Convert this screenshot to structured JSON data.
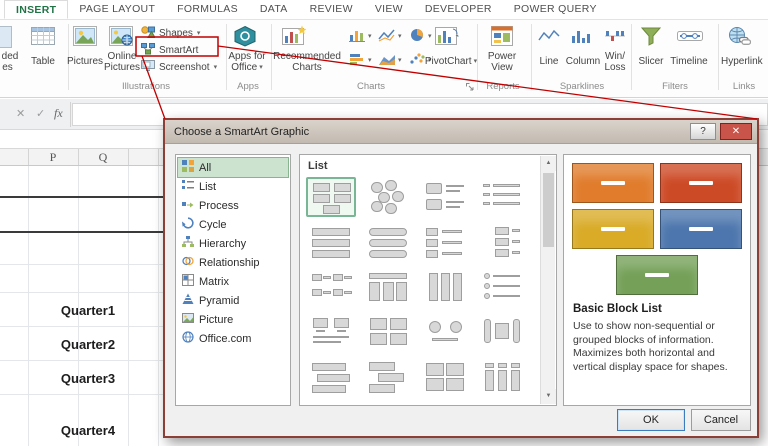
{
  "ribbon": {
    "dropdown_glyph": "▾",
    "tabs": [
      {
        "label": "INSERT",
        "active": true
      },
      {
        "label": "PAGE LAYOUT",
        "active": false
      },
      {
        "label": "FORMULAS",
        "active": false
      },
      {
        "label": "DATA",
        "active": false
      },
      {
        "label": "REVIEW",
        "active": false
      },
      {
        "label": "VIEW",
        "active": false
      },
      {
        "label": "DEVELOPER",
        "active": false
      },
      {
        "label": "POWER QUERY",
        "active": false
      }
    ],
    "groups": {
      "tables": {
        "partial_button_line1": "ded",
        "partial_button_line2": "es",
        "table": "Table"
      },
      "illustrations": {
        "label": "Illustrations",
        "pictures": "Pictures",
        "online_line1": "Online",
        "online_line2": "Pictures",
        "shapes": "Shapes",
        "smartart": "SmartArt",
        "screenshot": "Screenshot"
      },
      "apps": {
        "label": "Apps",
        "line1": "Apps for",
        "line2": "Office"
      },
      "charts": {
        "label": "Charts",
        "recommended_line1": "Recommended",
        "recommended_line2": "Charts",
        "pivotchart": "PivotChart",
        "mini_buttons": [
          "column",
          "line",
          "pie",
          "bar",
          "area",
          "scatter"
        ]
      },
      "reports": {
        "label": "Reports",
        "power_view_line1": "Power",
        "power_view_line2": "View"
      },
      "sparklines": {
        "label": "Sparklines",
        "line": "Line",
        "column": "Column",
        "winloss_line1": "Win/",
        "winloss_line2": "Loss"
      },
      "filters": {
        "label": "Filters",
        "slicer": "Slicer",
        "timeline": "Timeline"
      },
      "links": {
        "label": "Links",
        "hyperlink": "Hyperlink"
      }
    }
  },
  "formula_bar": {
    "cancel_glyph": "✕",
    "enter_glyph": "✓",
    "fx_label": "fx"
  },
  "sheet": {
    "column_headers": [
      "P",
      "Q"
    ],
    "row_labels": [
      "Quarter1",
      "Quarter2",
      "Quarter3",
      "Quarter4"
    ]
  },
  "dialog": {
    "title": "Choose a SmartArt Graphic",
    "help_glyph": "?",
    "close_glyph": "✕",
    "categories": [
      {
        "label": "All",
        "icon": "all-icon",
        "selected": true
      },
      {
        "label": "List",
        "icon": "list-icon",
        "selected": false
      },
      {
        "label": "Process",
        "icon": "process-icon",
        "selected": false
      },
      {
        "label": "Cycle",
        "icon": "cycle-icon",
        "selected": false
      },
      {
        "label": "Hierarchy",
        "icon": "hierarchy-icon",
        "selected": false
      },
      {
        "label": "Relationship",
        "icon": "relationship-icon",
        "selected": false
      },
      {
        "label": "Matrix",
        "icon": "matrix-icon",
        "selected": false
      },
      {
        "label": "Pyramid",
        "icon": "pyramid-icon",
        "selected": false
      },
      {
        "label": "Picture",
        "icon": "picture-icon",
        "selected": false
      },
      {
        "label": "Office.com",
        "icon": "office-com-icon",
        "selected": false
      }
    ],
    "gallery": {
      "section_label": "List",
      "scroll_up_glyph": "▲",
      "scroll_down_glyph": "▼",
      "thumbnails": [
        {
          "pattern": "blocks",
          "selected": true
        },
        {
          "pattern": "hexagons",
          "selected": false
        },
        {
          "pattern": "picture-rows",
          "selected": false
        },
        {
          "pattern": "bullet-rows",
          "selected": false
        },
        {
          "pattern": "wide-bars",
          "selected": false
        },
        {
          "pattern": "wide-bars-rounded",
          "selected": false
        },
        {
          "pattern": "box-caption-rows",
          "selected": false
        },
        {
          "pattern": "vertical-boxes",
          "selected": false
        },
        {
          "pattern": "paired-grid",
          "selected": false
        },
        {
          "pattern": "header-table",
          "selected": false
        },
        {
          "pattern": "column-boxes",
          "selected": false
        },
        {
          "pattern": "bullet-list",
          "selected": false
        },
        {
          "pattern": "monitor-pair",
          "selected": false
        },
        {
          "pattern": "tile-grid",
          "selected": false
        },
        {
          "pattern": "circle-pair",
          "selected": false
        },
        {
          "pattern": "bracket-pair",
          "selected": false
        },
        {
          "pattern": "banner-stack",
          "selected": false
        },
        {
          "pattern": "staggered-bars",
          "selected": false
        },
        {
          "pattern": "big-tiles",
          "selected": false
        },
        {
          "pattern": "capped-columns",
          "selected": false
        }
      ]
    },
    "preview": {
      "title": "Basic Block List",
      "description": "Use to show non-sequential or grouped blocks of information. Maximizes both horizontal and vertical display space for shapes.",
      "block_colors": [
        "#e07c2c",
        "#cd4a26",
        "#d9ab27",
        "#4c76ad",
        "#74a058"
      ]
    },
    "buttons": {
      "ok": "OK",
      "cancel": "Cancel"
    }
  },
  "annotation": {
    "color": "#c00000"
  }
}
